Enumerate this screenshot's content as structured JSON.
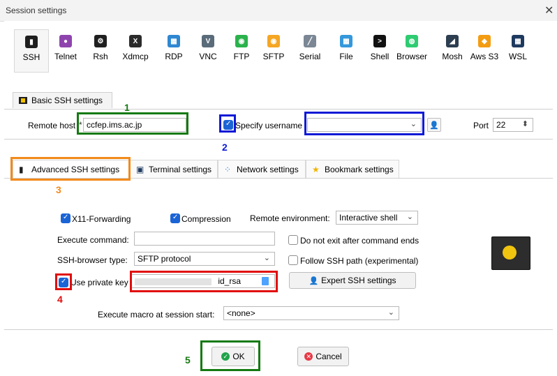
{
  "window": {
    "title": "Session settings",
    "close_glyph": "✕"
  },
  "toolbar": [
    {
      "label": "SSH",
      "icon": "ssh-icon",
      "color": "#1f1f1f",
      "glyph": "▮"
    },
    {
      "label": "Telnet",
      "icon": "telnet-icon",
      "color": "#8e44ad",
      "glyph": "●"
    },
    {
      "label": "Rsh",
      "icon": "rsh-icon",
      "color": "#1f1f1f",
      "glyph": "⚙"
    },
    {
      "label": "Xdmcp",
      "icon": "xdmcp-icon",
      "color": "#2b2b2b",
      "glyph": "X"
    },
    {
      "label": "RDP",
      "icon": "rdp-icon",
      "color": "#2f87d1",
      "glyph": "▦"
    },
    {
      "label": "VNC",
      "icon": "vnc-icon",
      "color": "#5a6b7a",
      "glyph": "V"
    },
    {
      "label": "FTP",
      "icon": "ftp-icon",
      "color": "#2bb24c",
      "glyph": "◉"
    },
    {
      "label": "SFTP",
      "icon": "sftp-icon",
      "color": "#f5a623",
      "glyph": "◉"
    },
    {
      "label": "Serial",
      "icon": "serial-icon",
      "color": "#7b8794",
      "glyph": "╱"
    },
    {
      "label": "File",
      "icon": "file-icon",
      "color": "#3498db",
      "glyph": "▦"
    },
    {
      "label": "Shell",
      "icon": "shell-icon",
      "color": "#111111",
      "glyph": ">"
    },
    {
      "label": "Browser",
      "icon": "browser-icon",
      "color": "#2ecc71",
      "glyph": "◍"
    },
    {
      "label": "Mosh",
      "icon": "mosh-icon",
      "color": "#2c3e50",
      "glyph": "◢"
    },
    {
      "label": "Aws S3",
      "icon": "aws-s3-icon",
      "color": "#f39c12",
      "glyph": "◆"
    },
    {
      "label": "WSL",
      "icon": "wsl-icon",
      "color": "#1e3a5f",
      "glyph": "▦"
    }
  ],
  "basic": {
    "tab_label": "Basic SSH settings",
    "remote_host_label": "Remote host",
    "remote_host_value": "ccfep.ims.ac.jp",
    "specify_username_label": "Specify username",
    "username_value": "",
    "port_label": "Port",
    "port_value": "22"
  },
  "adv_tabs": [
    {
      "label": "Advanced SSH settings"
    },
    {
      "label": "Terminal settings"
    },
    {
      "label": "Network settings"
    },
    {
      "label": "Bookmark settings"
    }
  ],
  "advanced": {
    "x11_label": "X11-Forwarding",
    "compression_label": "Compression",
    "remote_env_label": "Remote environment:",
    "remote_env_value": "Interactive shell",
    "execute_command_label": "Execute command:",
    "execute_command_value": "",
    "do_not_exit_label": "Do not exit after command ends",
    "ssh_browser_label": "SSH-browser type:",
    "ssh_browser_value": "SFTP protocol",
    "follow_ssh_label": "Follow SSH path (experimental)",
    "use_private_key_label": "Use private key",
    "private_key_value": "id_rsa",
    "expert_button": "Expert SSH settings",
    "macro_label": "Execute macro at session start:",
    "macro_value": "<none>"
  },
  "buttons": {
    "ok": "OK",
    "cancel": "Cancel"
  },
  "annotations": [
    "1",
    "2",
    "3",
    "4",
    "5"
  ],
  "colors": {
    "green": "#157a12",
    "blue": "#0d19d6",
    "orange": "#f28a1a",
    "red": "#e10d0d",
    "accent": "#1b64d6"
  }
}
